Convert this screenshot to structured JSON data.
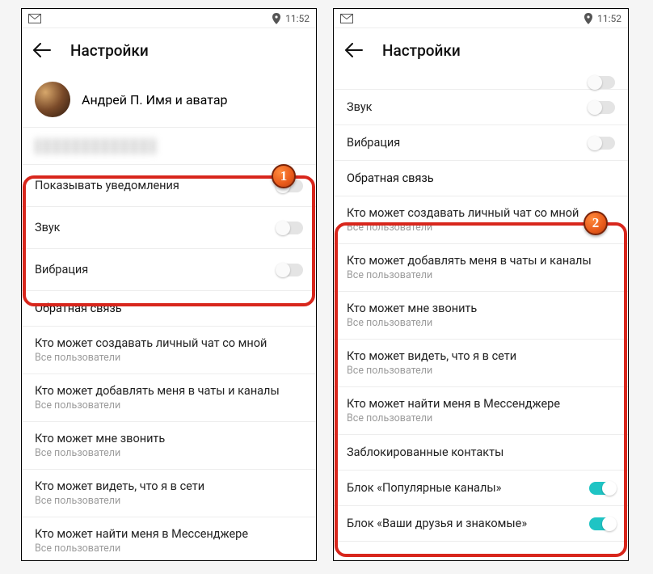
{
  "statusbar": {
    "time": "11:52"
  },
  "appbar": {
    "title": "Настройки"
  },
  "profile": {
    "name": "Андрей П.",
    "subtitle": "Имя и аватар"
  },
  "toggles": {
    "notifications": "Показывать уведомления",
    "sound": "Звук",
    "vibration": "Вибрация"
  },
  "feedback": "Обратная связь",
  "privacy": [
    {
      "title": "Кто может создавать личный чат со мной",
      "value": "Все пользователи"
    },
    {
      "title": "Кто может добавлять меня в чаты и каналы",
      "value": "Все пользователи"
    },
    {
      "title": "Кто может мне звонить",
      "value": "Все пользователи"
    },
    {
      "title": "Кто может видеть, что я в сети",
      "value": "Все пользователи"
    },
    {
      "title": "Кто может найти меня в Мессенджере",
      "value": "Все пользователи"
    }
  ],
  "blocked": "Заблокированные контакты",
  "blocks": {
    "popular": "Блок «Популярные каналы»",
    "friends": "Блок «Ваши друзья и знакомые»"
  },
  "badges": {
    "one": "1",
    "two": "2"
  }
}
